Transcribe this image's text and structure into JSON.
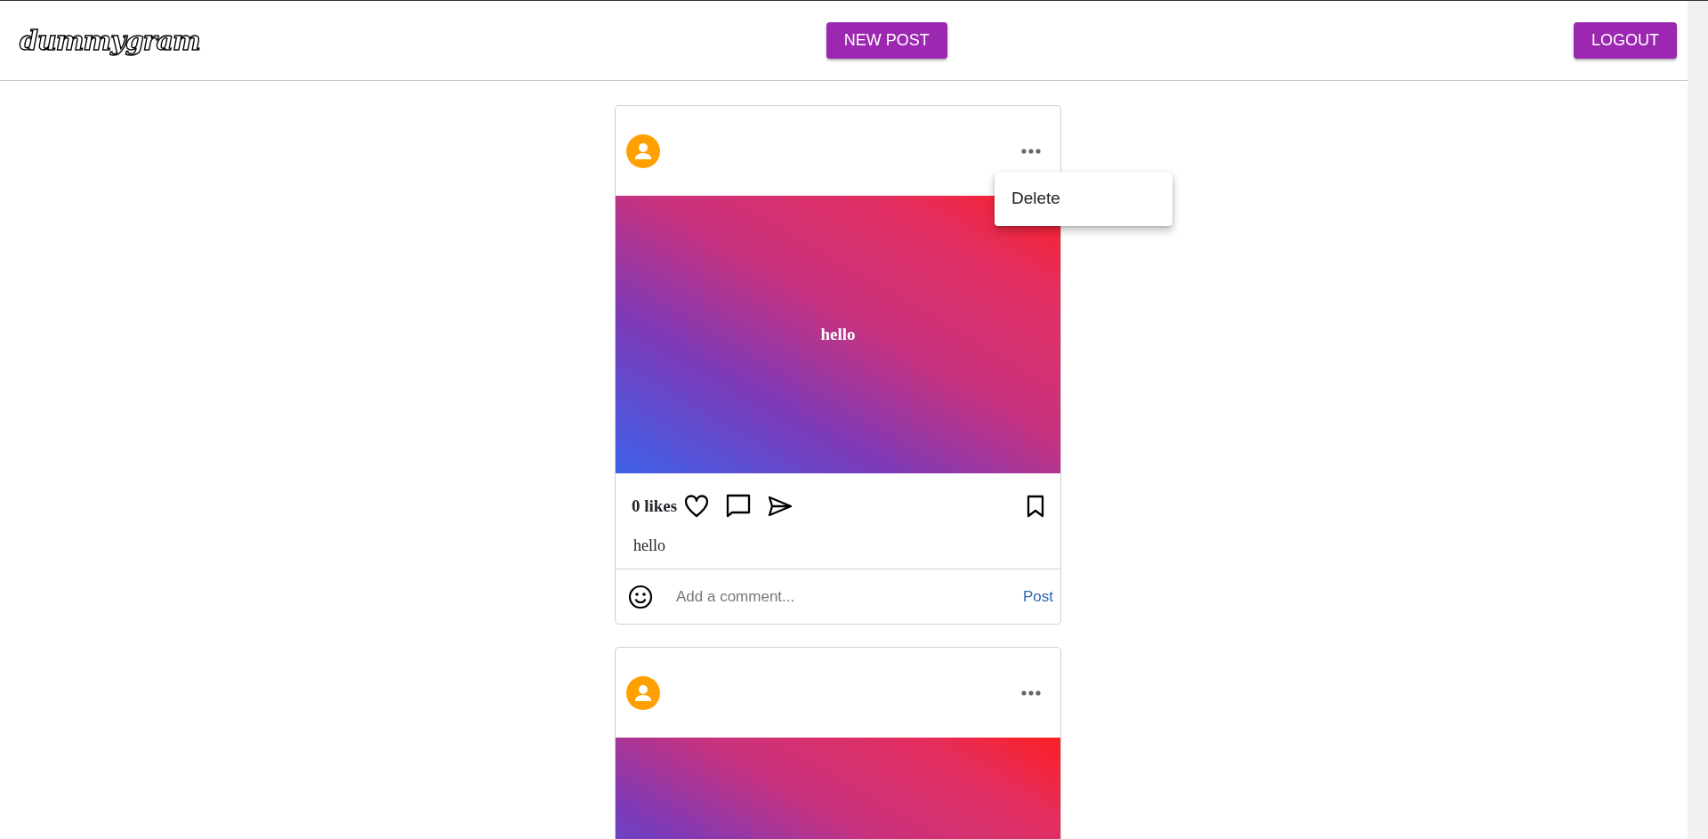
{
  "header": {
    "logo": "dummygram",
    "new_post_button": "NEW POST",
    "logout_button": "LOGOUT"
  },
  "posts": [
    {
      "kind": "full",
      "image_text": "hello",
      "likes": "0 likes",
      "caption": "hello",
      "comment_placeholder": "Add a comment...",
      "post_button": "Post",
      "menu": {
        "items": [
          "Delete"
        ]
      }
    },
    {
      "kind": "partial"
    }
  ]
}
